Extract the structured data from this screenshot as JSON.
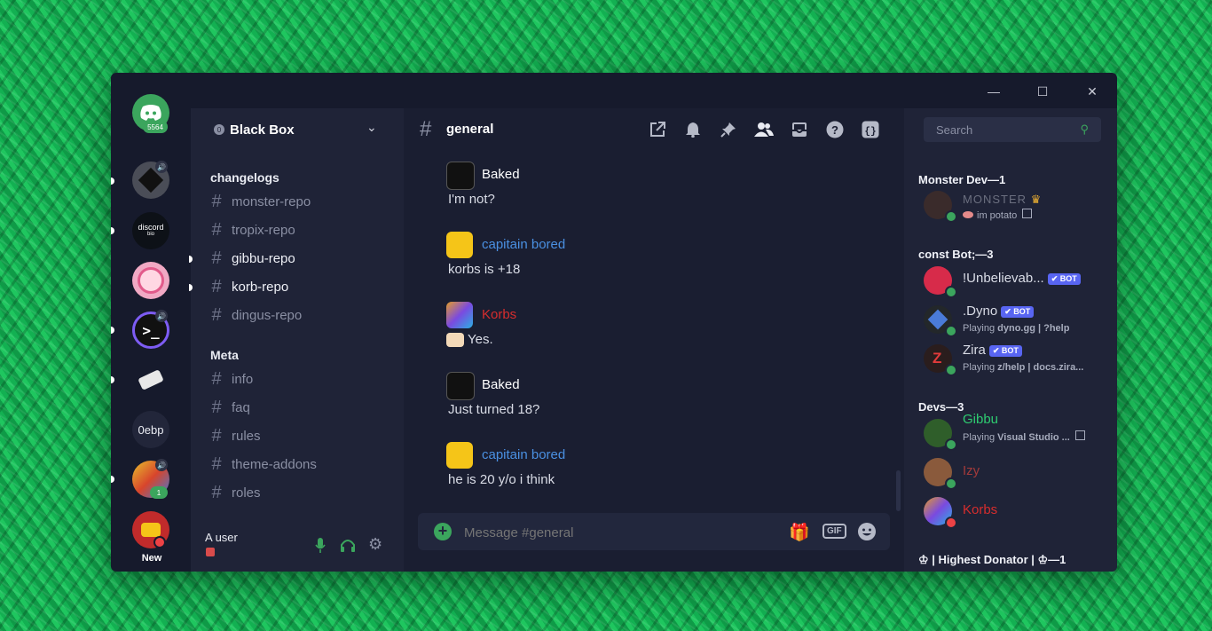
{
  "window": {
    "minimize": "—",
    "maximize": "☐",
    "close": "✕"
  },
  "rail": {
    "home_badge": "5564",
    "discord_bio_line1": "discord",
    "discord_bio_line2": "bio",
    "oebp_label": "0ebp",
    "count_badge": "1",
    "new_label": "New"
  },
  "server": {
    "name": "Black Box"
  },
  "categories": [
    {
      "name": "changelogs",
      "channels": [
        "monster-repo",
        "tropix-repo",
        "gibbu-repo",
        "korb-repo",
        "dingus-repo"
      ]
    },
    {
      "name": "Meta",
      "channels": [
        "info",
        "faq",
        "rules",
        "theme-addons",
        "roles"
      ]
    }
  ],
  "user_panel": {
    "name": "A user"
  },
  "chat": {
    "channel": "general",
    "placeholder": "Message #general",
    "gif_label": "GIF",
    "messages": [
      {
        "author": "Baked",
        "text": "I'm not?",
        "color": "#ffffff"
      },
      {
        "author": "capitain bored",
        "text": "korbs is +18",
        "color": "#4a90e2"
      },
      {
        "author": "Korbs",
        "text": "Yes.",
        "color": "#d62d2d"
      },
      {
        "author": "Baked",
        "text": "Just turned 18?",
        "color": "#ffffff"
      },
      {
        "author": "capitain bored",
        "text": "he is 20 y/o i think",
        "color": "#4a90e2"
      }
    ]
  },
  "members": {
    "search_placeholder": "Search",
    "groups": [
      {
        "header": "Monster Dev—1",
        "members": [
          {
            "name": "MONSTER",
            "sub": "im potato",
            "color": "#6b6f7f"
          }
        ]
      },
      {
        "header": "const Bot;—3",
        "members": [
          {
            "name": "!Unbelievab...",
            "tag": "BOT",
            "color": "#d9dce6"
          },
          {
            "name": ".Dyno",
            "tag": "BOT",
            "sub_prefix": "Playing ",
            "sub": "dyno.gg | ?help",
            "color": "#d9dce6"
          },
          {
            "name": "Zira",
            "tag": "BOT",
            "sub_prefix": "Playing ",
            "sub": "z/help | docs.zira...",
            "color": "#d9dce6"
          }
        ]
      },
      {
        "header": "Devs—3",
        "members": [
          {
            "name": "Gibbu",
            "sub_prefix": "Playing ",
            "sub": "Visual Studio ...",
            "color": "#2ecc71"
          },
          {
            "name": "Izy",
            "color": "#a33a3a"
          },
          {
            "name": "Korbs",
            "color": "#d62d2d"
          }
        ]
      },
      {
        "header": "♔ | Highest Donator | ♔—1",
        "members": []
      }
    ]
  }
}
